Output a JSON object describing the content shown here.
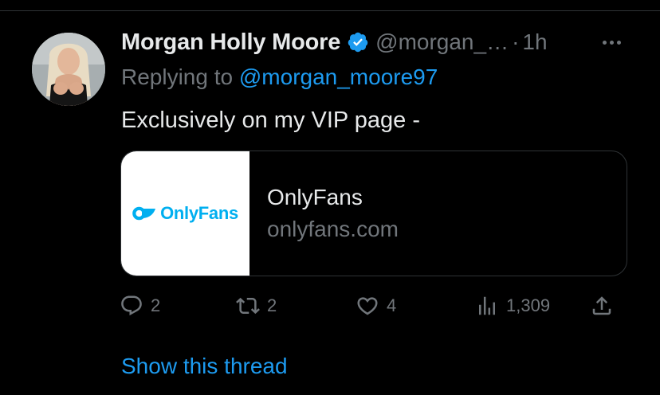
{
  "tweet": {
    "author": {
      "display_name": "Morgan Holly Moore",
      "handle": "@morgan_…",
      "verified": true
    },
    "separator": "·",
    "time": "1h",
    "replying_prefix": "Replying to ",
    "replying_to": "@morgan_moore97",
    "text": "Exclusively on my VIP page -",
    "card": {
      "thumbnail_logo_text": "OnlyFans",
      "title": "OnlyFans",
      "domain": "onlyfans.com"
    },
    "actions": {
      "replies": "2",
      "retweets": "2",
      "likes": "4",
      "views": "1,309"
    },
    "show_thread_label": "Show this thread"
  },
  "colors": {
    "background": "#000000",
    "text_primary": "#e7e9ea",
    "text_secondary": "#71767b",
    "accent": "#1d9bf0",
    "border": "#2f3336",
    "brand": "#00aff0"
  },
  "icons": [
    "more-icon",
    "verified-badge-icon",
    "reply-icon",
    "retweet-icon",
    "like-icon",
    "views-icon",
    "share-icon",
    "onlyfans-logo-icon"
  ]
}
